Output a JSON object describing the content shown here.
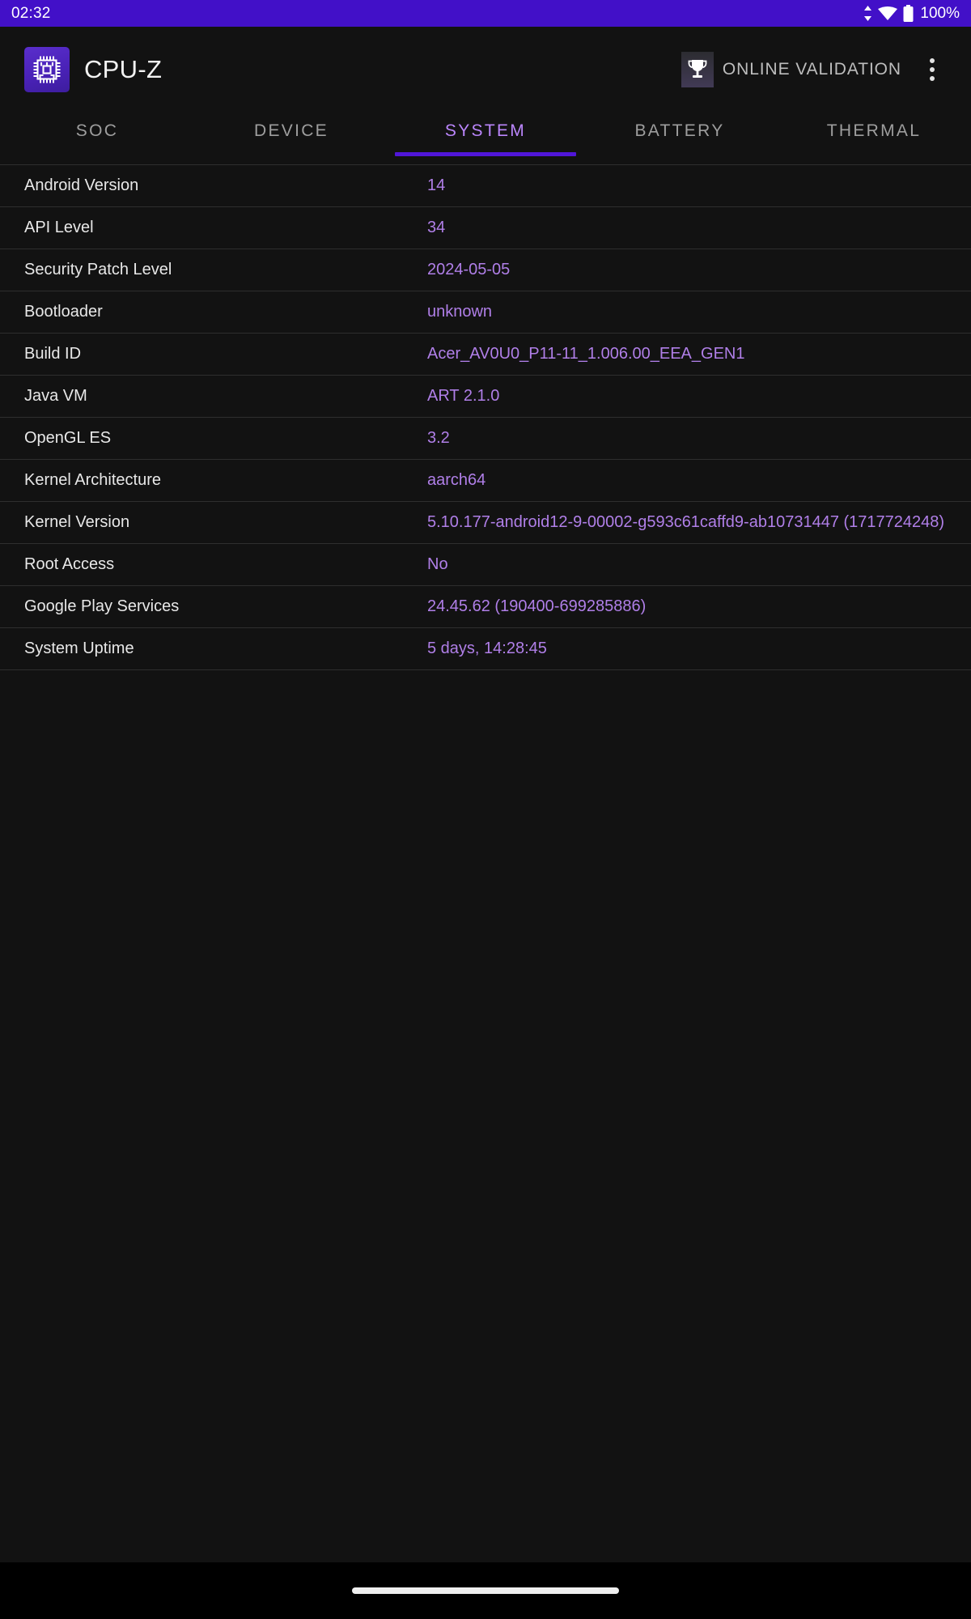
{
  "status_bar": {
    "clock": "02:32",
    "battery_percent": "100%",
    "icons": [
      "data-transfer-icon",
      "wifi-icon",
      "battery-icon"
    ],
    "background_color": "#4210c8"
  },
  "app_bar": {
    "app_icon": "cpu-chip-icon",
    "title": "CPU-Z",
    "validation_icon": "trophy-icon",
    "validation_label": "ONLINE VALIDATION",
    "overflow_icon": "more-vertical-icon"
  },
  "tabs": {
    "items": [
      {
        "label": "SOC",
        "active": false
      },
      {
        "label": "DEVICE",
        "active": false
      },
      {
        "label": "SYSTEM",
        "active": true
      },
      {
        "label": "BATTERY",
        "active": false
      },
      {
        "label": "THERMAL",
        "active": false
      }
    ],
    "active_index": 2,
    "active_color": "#bb86fc",
    "inactive_color": "#9e9e9e",
    "indicator_color": "#5016d8"
  },
  "system_info": {
    "value_color": "#b07fe8",
    "label_color": "#e8e8e8",
    "rows": [
      {
        "label": "Android Version",
        "value": "14"
      },
      {
        "label": "API Level",
        "value": "34"
      },
      {
        "label": "Security Patch Level",
        "value": "2024-05-05"
      },
      {
        "label": "Bootloader",
        "value": "unknown"
      },
      {
        "label": "Build ID",
        "value": "Acer_AV0U0_P11-11_1.006.00_EEA_GEN1"
      },
      {
        "label": "Java VM",
        "value": "ART 2.1.0"
      },
      {
        "label": "OpenGL ES",
        "value": "3.2"
      },
      {
        "label": "Kernel Architecture",
        "value": "aarch64"
      },
      {
        "label": "Kernel Version",
        "value": "5.10.177-android12-9-00002-g593c61caffd9-ab10731447 (1717724248)"
      },
      {
        "label": "Root Access",
        "value": "No"
      },
      {
        "label": "Google Play Services",
        "value": "24.45.62 (190400-699285886)"
      },
      {
        "label": "System Uptime",
        "value": "5 days, 14:28:45"
      }
    ]
  },
  "navigation_bar": {
    "gesture_pill": "home-gesture-pill"
  }
}
